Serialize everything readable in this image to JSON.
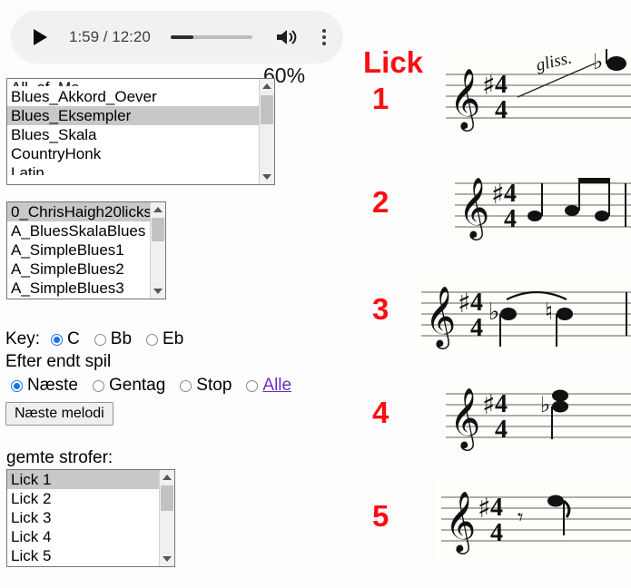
{
  "player": {
    "play_icon": "play-icon",
    "current_time": "1:59",
    "separator": "/",
    "duration": "12:20",
    "time_display": "1:59 / 12:20",
    "volume_icon": "volume-icon",
    "volume_percent": 27,
    "more_options_icon": "kebab-menu-icon"
  },
  "tempo": {
    "label": "60%"
  },
  "melody_list": {
    "name": "melody-listbox",
    "items": [
      {
        "label": "All_of_Me",
        "selected": false,
        "clipped": true
      },
      {
        "label": "Blues_Akkord_Oever",
        "selected": false
      },
      {
        "label": "Blues_Eksempler",
        "selected": true
      },
      {
        "label": "Blues_Skala",
        "selected": false
      },
      {
        "label": "CountryHonk",
        "selected": false
      },
      {
        "label": "Latin",
        "selected": false,
        "clipped": true
      }
    ]
  },
  "file_list": {
    "name": "file-listbox",
    "items": [
      {
        "label": "0_ChrisHaigh20licks",
        "selected": true
      },
      {
        "label": "A_BluesSkalaBlues",
        "selected": false
      },
      {
        "label": "A_SimpleBlues1",
        "selected": false
      },
      {
        "label": "A_SimpleBlues2",
        "selected": false
      },
      {
        "label": "A_SimpleBlues3",
        "selected": false
      }
    ]
  },
  "key_row": {
    "label": "Key:",
    "options": [
      {
        "label": "C",
        "selected": true
      },
      {
        "label": "Bb",
        "selected": false
      },
      {
        "label": "Eb",
        "selected": false
      }
    ]
  },
  "after_play": {
    "label": "Efter endt spil",
    "options": [
      {
        "label": "Næste",
        "selected": true,
        "link": false
      },
      {
        "label": "Gentag",
        "selected": false,
        "link": false
      },
      {
        "label": "Stop",
        "selected": false,
        "link": false
      },
      {
        "label": "Alle",
        "selected": false,
        "link": true
      }
    ]
  },
  "next_button": {
    "label": "Næste melodi"
  },
  "saved_strofer": {
    "label": "gemte strofer:",
    "items": [
      {
        "label": "Lick 1",
        "selected": true
      },
      {
        "label": "Lick 2",
        "selected": false
      },
      {
        "label": "Lick 3",
        "selected": false
      },
      {
        "label": "Lick 4",
        "selected": false
      },
      {
        "label": "Lick 5",
        "selected": false
      }
    ]
  },
  "licks_panel": {
    "heading": "Lick",
    "accent_color": "#fc0d12",
    "items": [
      {
        "number": "1",
        "annotation": "gliss.",
        "clef": "treble",
        "key_signature": "1 sharp",
        "time_signature": "4/4"
      },
      {
        "number": "2",
        "annotation": "",
        "clef": "treble",
        "key_signature": "1 sharp",
        "time_signature": "4/4"
      },
      {
        "number": "3",
        "annotation": "",
        "clef": "treble",
        "key_signature": "1 sharp",
        "time_signature": "4/4"
      },
      {
        "number": "4",
        "annotation": "",
        "clef": "treble",
        "key_signature": "1 sharp",
        "time_signature": "4/4"
      },
      {
        "number": "5",
        "annotation": "",
        "clef": "treble",
        "key_signature": "1 sharp",
        "time_signature": "4/4"
      }
    ]
  }
}
